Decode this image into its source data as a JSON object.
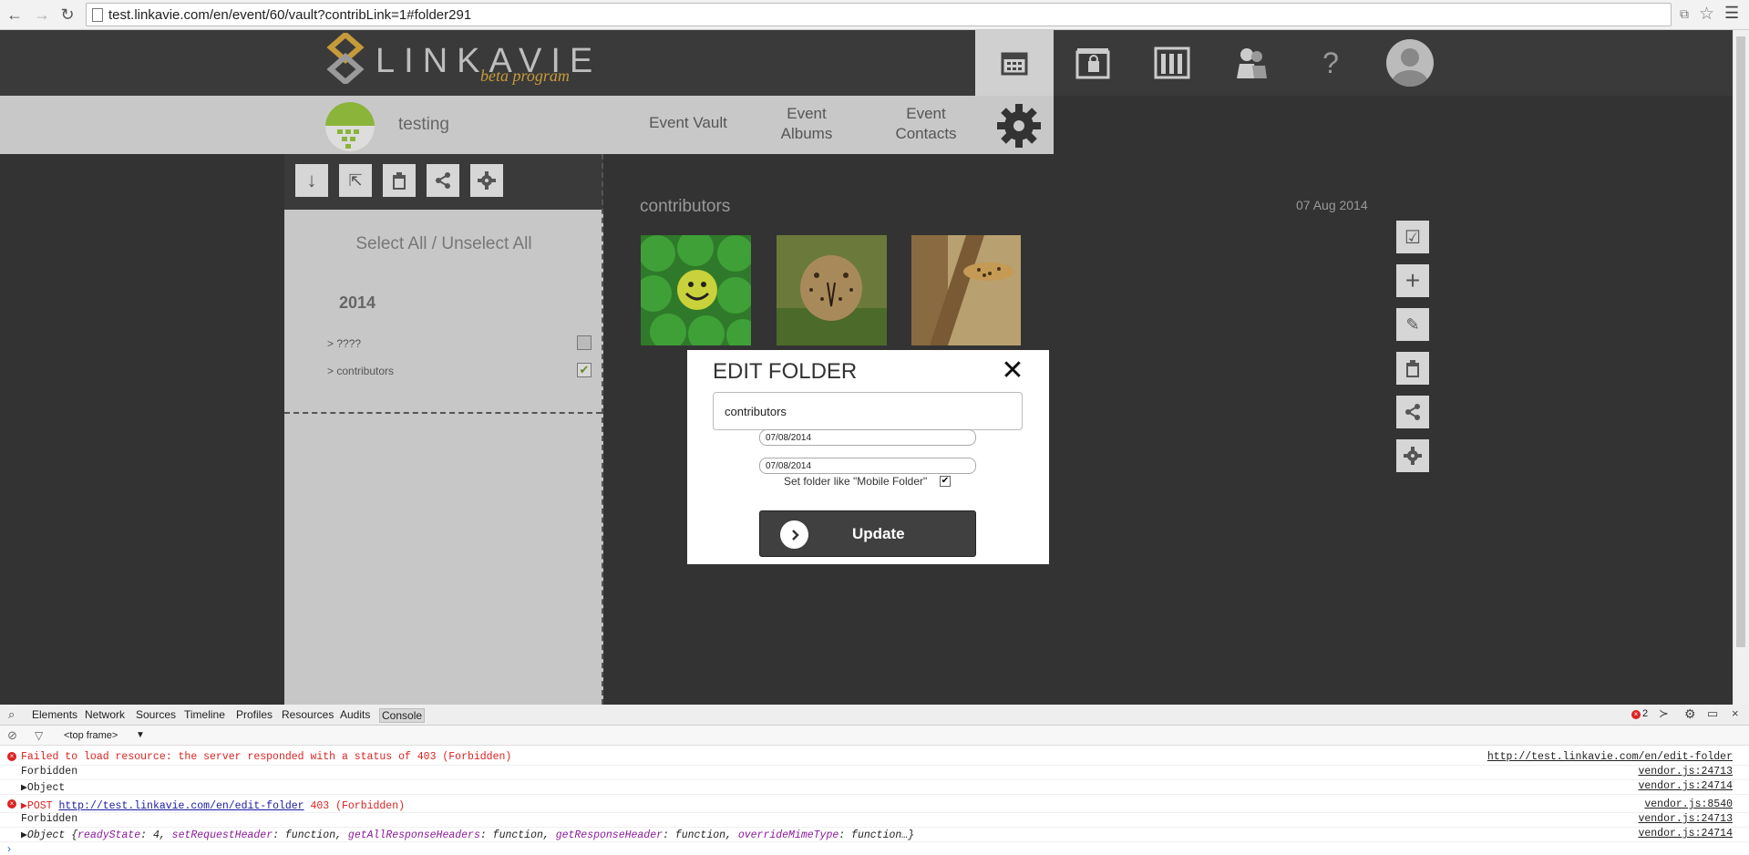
{
  "browser": {
    "url": "test.linkavie.com/en/event/60/vault?contribLink=1#folder291",
    "back_icon": "back-arrow-icon",
    "forward_icon": "forward-arrow-icon",
    "reload_icon": "reload-icon"
  },
  "app": {
    "logo_text": "LINKAVIE",
    "logo_sub": "beta program",
    "header_icons": [
      "calendar-icon",
      "photo-lock-icon",
      "columns-icon",
      "users-icon",
      "help-icon",
      "profile-avatar"
    ],
    "help_label": "?",
    "event_name": "testing",
    "subnav": {
      "vault": "Event Vault",
      "albums_1": "Event",
      "albums_2": "Albums",
      "contacts_1": "Event",
      "contacts_2": "Contacts"
    }
  },
  "sidebar": {
    "select_all": "Select All / Unselect All",
    "year": "2014",
    "items": [
      {
        "label": "> ????",
        "checked": false
      },
      {
        "label": "> contributors",
        "checked": true
      }
    ]
  },
  "main": {
    "folder_title": "contributors",
    "folder_date": "07 Aug 2014"
  },
  "modal": {
    "title": "EDIT FOLDER",
    "close": "✕",
    "name_value": "contributors",
    "start_date": "07/08/2014",
    "end_date": "07/08/2014",
    "mobile_label": "Set folder like \"Mobile Folder\"",
    "mobile_checked": true,
    "update_label": "Update"
  },
  "devtools": {
    "tabs": [
      "Elements",
      "Network",
      "Sources",
      "Timeline",
      "Profiles",
      "Resources",
      "Audits",
      "Console"
    ],
    "frame": "<top frame>",
    "error_count": "2",
    "logs": [
      {
        "text": "Failed to load resource: the server responded with a status of 403 (Forbidden)",
        "src": "http://test.linkavie.com/en/edit-folder",
        "error": true
      },
      {
        "text": "Forbidden",
        "src": "vendor.js:24713",
        "error": false
      },
      {
        "text": "▶Object",
        "src": "vendor.js:24714",
        "error": false
      },
      {
        "text_prefix": "▶POST ",
        "link": "http://test.linkavie.com/en/edit-folder",
        "text_suffix": " 403 (Forbidden)",
        "src": "vendor.js:8540",
        "error": true
      },
      {
        "text": "Forbidden",
        "src": "vendor.js:24713",
        "error": false
      },
      {
        "src": "vendor.js:24714",
        "error": false
      }
    ],
    "object_line": {
      "prefix": "▶Object {",
      "k1": "readyState",
      "v1": ": 4, ",
      "k2": "setRequestHeader",
      "v2": ": function, ",
      "k3": "getAllResponseHeaders",
      "v3": ": function, ",
      "k4": "getResponseHeader",
      "v4": ": function, ",
      "k5": "overrideMimeType",
      "v5": ": function…}"
    }
  }
}
